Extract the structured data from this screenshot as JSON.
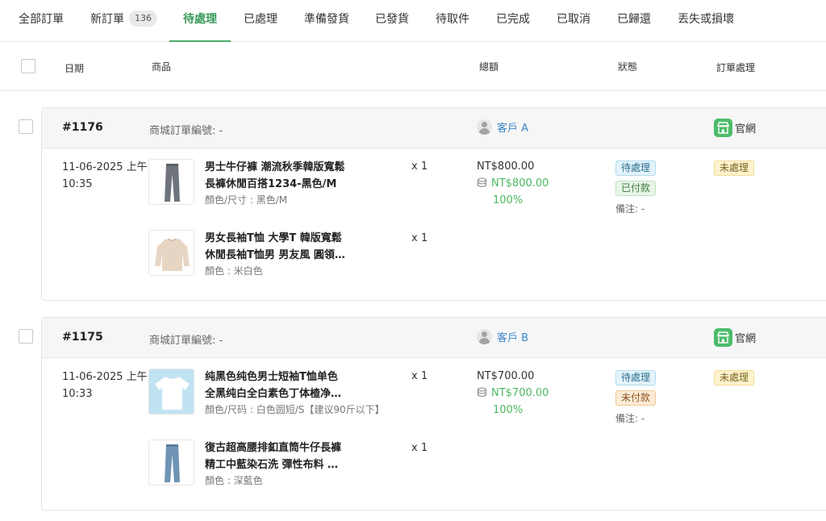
{
  "tabs": [
    {
      "label": "全部訂單"
    },
    {
      "label": "新訂單",
      "badge": "136"
    },
    {
      "label": "待處理"
    },
    {
      "label": "已處理"
    },
    {
      "label": "準備發貨"
    },
    {
      "label": "已發貨"
    },
    {
      "label": "待取件"
    },
    {
      "label": "已完成"
    },
    {
      "label": "已取消"
    },
    {
      "label": "已歸還"
    },
    {
      "label": "丟失或損壞"
    }
  ],
  "active_tab": "待處理",
  "columns": {
    "date": "日期",
    "product": "商品",
    "total": "總額",
    "status": "狀態",
    "processing": "訂單處理"
  },
  "accent_color": "#4caf6a",
  "orders": [
    {
      "id": "#1176",
      "mall_no": "商城訂單編號: -",
      "customer": "客戶 A",
      "channel": "官網",
      "date": "11-06-2025 上午",
      "time": "10:35",
      "total": "NT$800.00",
      "paid_amount": "NT$800.00",
      "paid_pct": "100%",
      "status_order": "待處理",
      "status_payment": "已付款",
      "note": "備注: -",
      "processing": "未處理",
      "items": [
        {
          "name_line1": "男士牛仔褲 潮流秋季韓版寬鬆",
          "name_line2": "長褲休閒百搭1234-黑色/M",
          "variant": "顏色/尺寸 : 黑色/M",
          "qty": "x 1",
          "thumb_icon": "gray-jeans-image"
        },
        {
          "name_line1": "男女長袖T恤 大學T 韓版寬鬆",
          "name_line2": "休閒長袖T恤男 男友風 圓領…",
          "variant": "顏色 : 米白色",
          "qty": "x 1",
          "thumb_icon": "beige-sweater-image"
        }
      ]
    },
    {
      "id": "#1175",
      "mall_no": "商城訂單編號: -",
      "customer": "客戶 B",
      "channel": "官網",
      "date": "11-06-2025 上午",
      "time": "10:33",
      "total": "NT$700.00",
      "paid_amount": "NT$700.00",
      "paid_pct": "100%",
      "status_order": "待處理",
      "status_payment": "未付款",
      "note": "備注: -",
      "processing": "未處理",
      "items": [
        {
          "name_line1": "纯黑色纯色男士短袖T恤单色",
          "name_line2": "全黑纯白全白素色丁体楂净…",
          "variant": "顏色/尺码 : 白色圆短/S【建议90斤以下】",
          "qty": "x 1",
          "thumb_icon": "white-tshirt-image"
        },
        {
          "name_line1": "復古超高腰排釦直筒牛仔長褲",
          "name_line2": "精工中藍染石洗 彈性布料 …",
          "variant": "顏色 : 深藍色",
          "qty": "x 1",
          "thumb_icon": "blue-jeans-image"
        }
      ]
    }
  ]
}
